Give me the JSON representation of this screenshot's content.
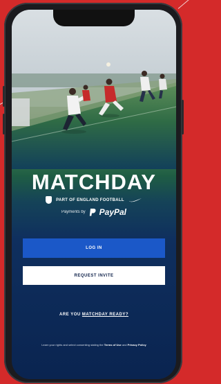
{
  "app": {
    "brand_name": "MATCHDAY",
    "subtitle": "PART OF ENGLAND FOOTBALL",
    "powered_by": "Payments by",
    "payment_brand": "PayPal"
  },
  "actions": {
    "login_label": "LOG IN",
    "request_invite_label": "REQUEST INVITE"
  },
  "ready_prompt": {
    "prefix": "ARE YOU ",
    "link": "MATCHDAY READY?"
  },
  "legal": {
    "text": "Learn your rights and select consenting stating the",
    "terms_link": "Terms of Use",
    "and": " and ",
    "privacy_link": "Privacy Policy"
  },
  "colors": {
    "frame_background": "#d42a2a",
    "screen_navy": "#0a2450",
    "pitch_green": "#2f6b45",
    "login_blue": "#1b58c8",
    "invite_white": "#ffffff"
  },
  "icons": [
    "england-shield-icon",
    "nike-swoosh-icon",
    "paypal-icon"
  ]
}
